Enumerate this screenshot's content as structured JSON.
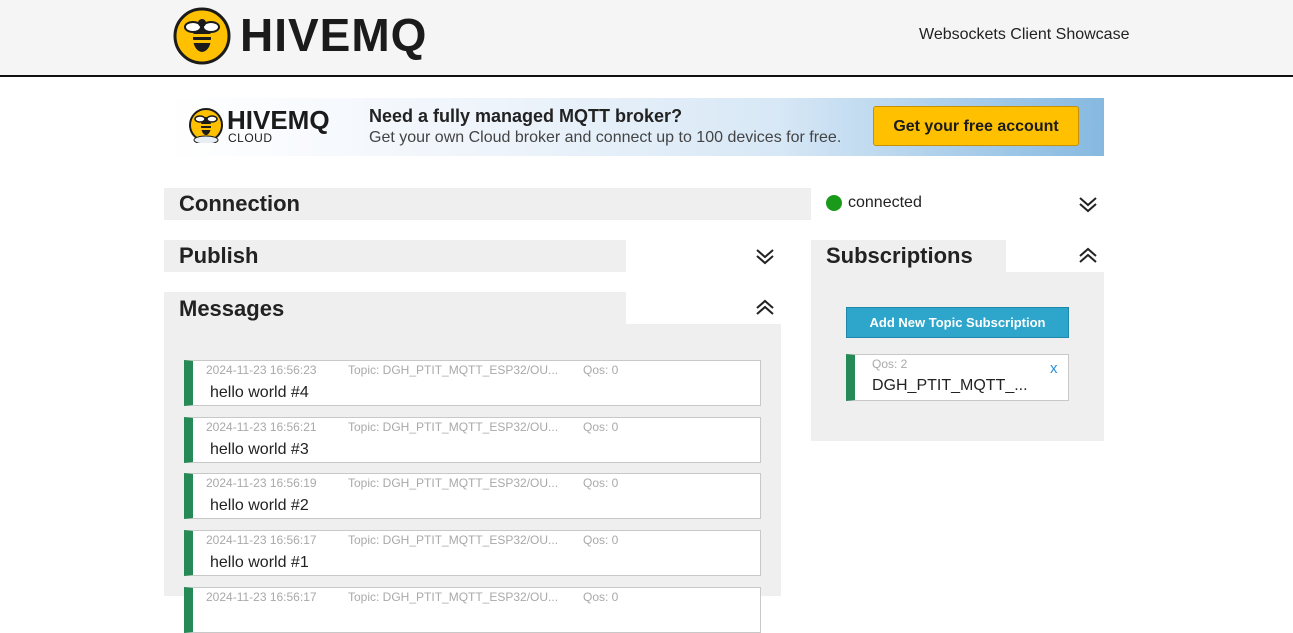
{
  "header": {
    "brand": "HIVEMQ",
    "subtitle": "Websockets Client Showcase"
  },
  "banner": {
    "brand": "HIVEMQ",
    "brand_sub": "CLOUD",
    "heading": "Need a fully managed MQTT broker?",
    "text": "Get your own Cloud broker and connect up to 100 devices for free.",
    "cta_label": "Get your free account"
  },
  "sections": {
    "connection": "Connection",
    "publish": "Publish",
    "messages": "Messages",
    "subscriptions": "Subscriptions"
  },
  "status": {
    "text": "connected",
    "color": "#1a9a1a"
  },
  "messages": [
    {
      "date": "2024-11-23 16:56:23",
      "topic": "Topic: DGH_PTIT_MQTT_ESP32/OU...",
      "qos": "Qos: 0",
      "body": "hello world #4"
    },
    {
      "date": "2024-11-23 16:56:21",
      "topic": "Topic: DGH_PTIT_MQTT_ESP32/OU...",
      "qos": "Qos: 0",
      "body": "hello world #3"
    },
    {
      "date": "2024-11-23 16:56:19",
      "topic": "Topic: DGH_PTIT_MQTT_ESP32/OU...",
      "qos": "Qos: 0",
      "body": "hello world #2"
    },
    {
      "date": "2024-11-23 16:56:17",
      "topic": "Topic: DGH_PTIT_MQTT_ESP32/OU...",
      "qos": "Qos: 0",
      "body": "hello world #1"
    },
    {
      "date": "2024-11-23 16:56:17",
      "topic": "Topic: DGH_PTIT_MQTT_ESP32/OU...",
      "qos": "Qos: 0",
      "body": ""
    }
  ],
  "subscriptions": {
    "add_label": "Add New Topic Subscription",
    "items": [
      {
        "qos": "Qos: 2",
        "topic": "DGH_PTIT_MQTT_...",
        "close": "x"
      }
    ]
  },
  "colors": {
    "accent_green": "#258a55",
    "cta_yellow": "#ffc000",
    "button_blue": "#2ea6cb"
  }
}
